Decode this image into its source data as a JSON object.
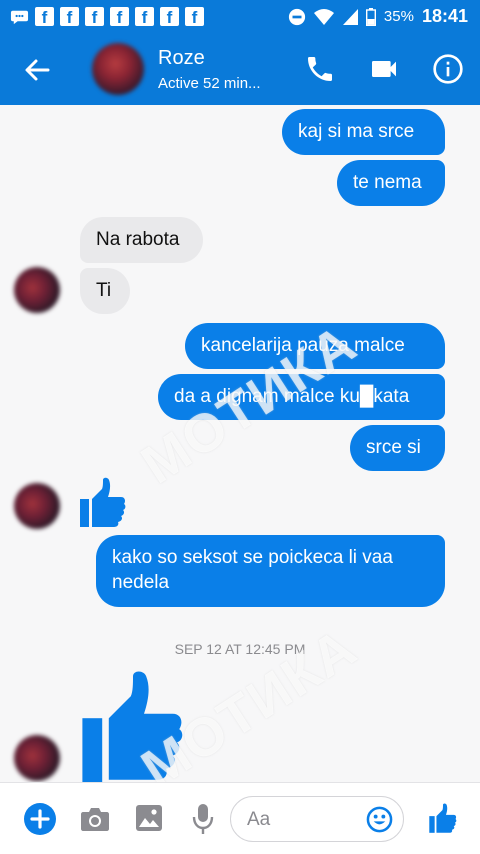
{
  "status_bar": {
    "battery_percent": "35%",
    "time": "18:41",
    "watermark": "МОТИКА"
  },
  "header": {
    "contact_name": "Roze",
    "contact_status": "Active 52 min..."
  },
  "messages": [
    {
      "side": "outgoing",
      "text": "kaj si ma srce"
    },
    {
      "side": "outgoing",
      "text": "te nema"
    },
    {
      "side": "incoming",
      "text": "Na rabota"
    },
    {
      "side": "incoming",
      "text": "Ti"
    },
    {
      "side": "outgoing",
      "text": "kancelarija pauza malce"
    },
    {
      "side": "outgoing",
      "text": "da a dignam malce ku█kata"
    },
    {
      "side": "outgoing",
      "text": "srce si"
    },
    {
      "side": "incoming",
      "type": "like",
      "icon": "thumbs-up-icon"
    },
    {
      "side": "outgoing",
      "text": "kako so seksot se poickeca li vaa nedela"
    },
    {
      "side": "incoming",
      "type": "like-large",
      "icon": "thumbs-up-icon"
    }
  ],
  "timestamp": "SEP 12 AT 12:45 PM",
  "watermark_text": "МОТИКА",
  "composer": {
    "placeholder": "Aa"
  },
  "colors": {
    "brand_blue": "#0a7ad9",
    "outgoing_bubble": "#0a7fe8",
    "incoming_bubble": "#e9e9eb",
    "like_blue": "#0a7fe8"
  }
}
